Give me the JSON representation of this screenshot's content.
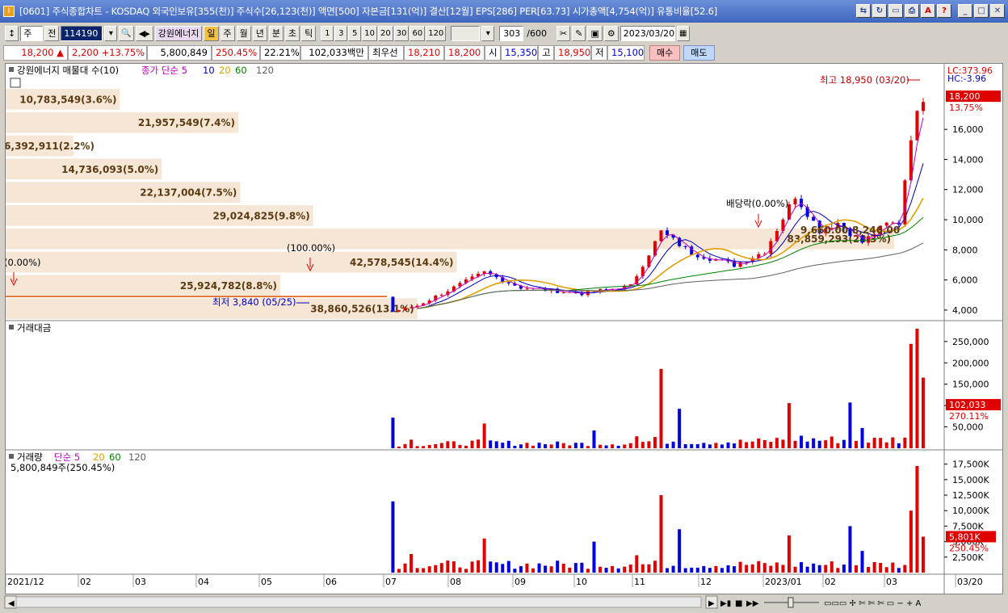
{
  "window": {
    "title": "[0601] 주식종합차트 - KOSDAQ 외국인보유[355(천)] 주식수[26,123(천)] 액면[500] 자본금[131(억)] 결산[12월] EPS[286] PER[63.73] 시가총액[4,754(억)] 유통비율[52.6]",
    "app_icon": "I"
  },
  "toolbar": {
    "period": "주",
    "prev": "전",
    "code": "114190",
    "stock_name": "강원에너지",
    "day": "일",
    "week": "주",
    "month": "월",
    "year": "년",
    "minute": "분",
    "second": "초",
    "tick": "틱",
    "intervals": [
      "1",
      "3",
      "5",
      "10",
      "20",
      "30",
      "60",
      "120"
    ],
    "count": "303",
    "count_max": "/600",
    "date": "2023/03/20"
  },
  "quote": {
    "price": "18,200",
    "change": "2,200",
    "change_pct": "+13.75%",
    "volume": "5,800,849",
    "volume_ratio": "250.45%",
    "turnover": "22.21%",
    "amount": "102,033백만",
    "best_label": "최우선",
    "ask": "18,210",
    "bid": "18,200",
    "open_label": "시",
    "open": "15,350",
    "high_label": "고",
    "high": "18,950",
    "low_label": "저",
    "low": "15,100",
    "buy": "매수",
    "sell": "매도"
  },
  "chart_data": {
    "type": "candlestick",
    "price_panel": {
      "title": "강원에너지 매물대 수(10)",
      "ma_title": "종가 단순",
      "ma_periods": [
        "5",
        "10",
        "20",
        "60",
        "120"
      ],
      "lc": "LC:373.96",
      "hc": "HC:-3.96",
      "current_price": "18,200",
      "current_pct": "13.75%",
      "high_note": "최고 18,950 (03/20)",
      "low_note": "최저 3,840 (05/25)",
      "note_100": "(100.00%)",
      "note_div": "배당락(0.00%)",
      "note_left": "(0.00%)",
      "y_ticks": [
        "16,000",
        "14,000",
        "12,000",
        "10,000",
        "8,000",
        "6,000",
        "4,000"
      ],
      "ylim": [
        3300,
        19600
      ],
      "volume_profile": [
        {
          "label": "10,783,549(3.6%)",
          "value": 10783549
        },
        {
          "label": "21,957,549(7.4%)",
          "value": 21957549
        },
        {
          "label": "6,392,911(2.2%)",
          "value": 6392911
        },
        {
          "label": "14,736,093(5.0%)",
          "value": 14736093
        },
        {
          "label": "22,137,004(7.5%)",
          "value": 22137004
        },
        {
          "label": "29,024,825(9.8%)",
          "value": 29024825
        },
        {
          "label": "83,859,293(28.3%)",
          "value": 83859293
        },
        {
          "label": "42,578,545(14.4%)",
          "value": 42578545
        },
        {
          "label": "25,924,782(8.8%)",
          "value": 25924782
        },
        {
          "label": "38,860,526(13.1%)",
          "value": 38860526
        }
      ],
      "overlay_labels": [
        "9,660.00",
        "8,246.00"
      ]
    },
    "amount_panel": {
      "title": "거래대금",
      "y_ticks": [
        "250,000",
        "200,000",
        "150,000",
        "100,000",
        "50,000"
      ],
      "current": "102,033",
      "current_pct": "270.11%"
    },
    "volume_panel": {
      "title": "거래량",
      "ma_title": "단순",
      "ma_periods": [
        "5",
        "20",
        "60",
        "120"
      ],
      "info": "5,800,849주(250.45%)",
      "y_ticks": [
        "17,500K",
        "15,000K",
        "12,500K",
        "10,000K",
        "7,500K",
        "5,000K",
        "2,500K"
      ],
      "current": "5,801K",
      "current_pct": "250.45%"
    },
    "x_labels": [
      "2021/12",
      "02",
      "03",
      "04",
      "05",
      "06",
      "07",
      "08",
      "09",
      "10",
      "11",
      "12",
      "2023/01",
      "02",
      "03",
      "03/20"
    ]
  },
  "colors": {
    "up": "#e00000",
    "down": "#0000e0",
    "profile": "#f5e6d6",
    "ma5": "#c000c0",
    "ma10": "#0000c0",
    "ma20": "#e0a000",
    "ma60": "#008000",
    "ma120": "#606060"
  }
}
